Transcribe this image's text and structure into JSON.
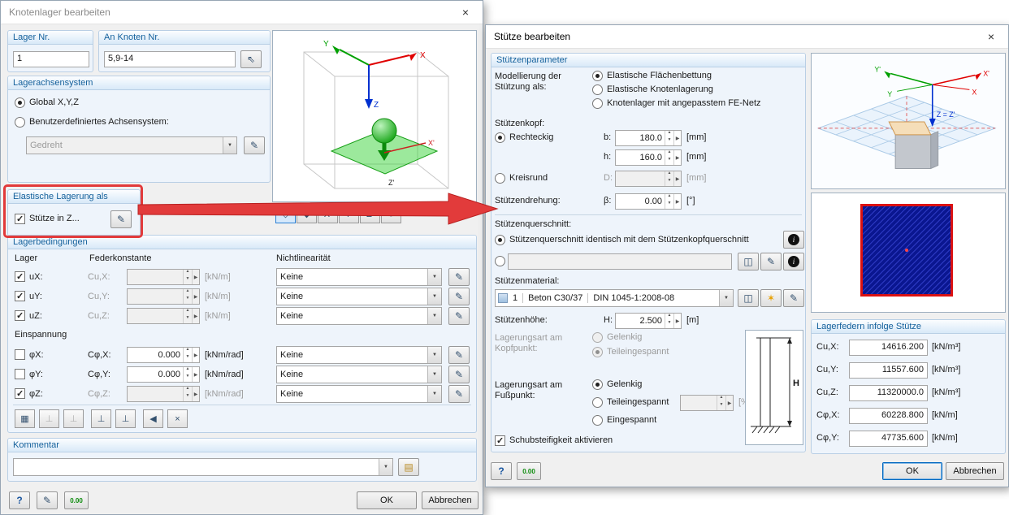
{
  "icons": {
    "close": "×",
    "pick": "⇖",
    "edit": "✎",
    "help": "?",
    "units": "0.00",
    "library": "◫",
    "new": "✶",
    "info": "i",
    "notes": "▤"
  },
  "left": {
    "title": "Knotenlager bearbeiten",
    "lager_nr": {
      "title": "Lager Nr.",
      "value": "1"
    },
    "an_knoten": {
      "title": "An Knoten Nr.",
      "value": "5,9-14"
    },
    "achsen": {
      "title": "Lagerachsensystem",
      "opt_global": "Global X,Y,Z",
      "opt_custom": "Benutzerdefiniertes Achsensystem:",
      "combo_value": "Gedreht"
    },
    "elastisch": {
      "title": "Elastische Lagerung als",
      "check_label": "Stütze in Z..."
    },
    "preview": {
      "axis_x": "X",
      "axis_y": "Y",
      "axis_z": "Z",
      "axis_xp": "X'",
      "axis_zp": "Z'",
      "toolbar": [
        "◇",
        "◆",
        "X'",
        "Y'",
        "Z'",
        "↺"
      ]
    },
    "bedingungen": {
      "title": "Lagerbedingungen",
      "col_lager": "Lager",
      "col_feder": "Federkonstante",
      "col_nl": "Nichtlinearität",
      "einspannung": "Einspannung",
      "rows": [
        {
          "label": "uX:",
          "coef": "Cu,X:",
          "value": "",
          "unit": "[kN/m]",
          "nl": "Keine"
        },
        {
          "label": "uY:",
          "coef": "Cu,Y:",
          "value": "",
          "unit": "[kN/m]",
          "nl": "Keine"
        },
        {
          "label": "uZ:",
          "coef": "Cu,Z:",
          "value": "",
          "unit": "[kN/m]",
          "nl": "Keine"
        },
        {
          "label": "φX:",
          "coef": "Cφ,X:",
          "value": "0.000",
          "unit": "[kNm/rad]",
          "nl": "Keine"
        },
        {
          "label": "φY:",
          "coef": "Cφ,Y:",
          "value": "0.000",
          "unit": "[kNm/rad]",
          "nl": "Keine"
        },
        {
          "label": "φZ:",
          "coef": "Cφ,Z:",
          "value": "",
          "unit": "[kNm/rad]",
          "nl": "Keine"
        }
      ],
      "presets": [
        "▦",
        "⊥",
        "⊥",
        "⊥",
        "⊥",
        "◀",
        "×"
      ]
    },
    "kommentar": {
      "title": "Kommentar",
      "value": ""
    },
    "ok": "OK",
    "cancel": "Abbrechen"
  },
  "right": {
    "title": "Stütze bearbeiten",
    "param_title": "Stützenparameter",
    "modellierung": {
      "label": "Modellierung der Stützung als:",
      "opt1": "Elastische Flächenbettung",
      "opt2": "Elastische Knotenlagerung",
      "opt3": "Knotenlager mit angepasstem FE-Netz"
    },
    "kopf": {
      "label": "Stützenkopf:",
      "opt_rect": "Rechteckig",
      "b_label": "b:",
      "b_value": "180.0",
      "b_unit": "[mm]",
      "h_label": "h:",
      "h_value": "160.0",
      "h_unit": "[mm]",
      "opt_round": "Kreisrund",
      "d_label": "D:",
      "d_value": "",
      "d_unit": "[mm]"
    },
    "drehung": {
      "label": "Stützendrehung:",
      "beta_label": "β:",
      "value": "0.00",
      "unit": "[°]"
    },
    "querschnitt": {
      "label": "Stützenquerschnitt:",
      "opt_identical": "Stützenquerschnitt identisch mit dem Stützenkopfquerschnitt",
      "custom_value": ""
    },
    "material": {
      "label": "Stützenmaterial:",
      "num": "1",
      "name": "Beton C30/37",
      "norm": "DIN 1045-1:2008-08"
    },
    "hoehe": {
      "label": "Stützenhöhe:",
      "h_label": "H:",
      "value": "2.500",
      "unit": "[m]"
    },
    "kopfpunkt": {
      "label": "Lagerungsart am Kopfpunkt:",
      "opt1": "Gelenkig",
      "opt2": "Teileingespannt"
    },
    "fusspunkt": {
      "label": "Lagerungsart am Fußpunkt:",
      "opt1": "Gelenkig",
      "opt2": "Teileingespannt",
      "opt2_value": "",
      "opt2_unit": "[%]",
      "opt3": "Eingespannt"
    },
    "schub": "Schubsteifigkeit aktivieren",
    "figure_h": "H",
    "preview": {
      "xp": "X'",
      "x": "X",
      "yp": "Y'",
      "y": "Y",
      "z": "Z = Z'"
    },
    "federn": {
      "title": "Lagerfedern infolge Stütze",
      "rows": [
        {
          "label": "Cu,X:",
          "value": "14616.200",
          "unit": "[kN/m³]"
        },
        {
          "label": "Cu,Y:",
          "value": "11557.600",
          "unit": "[kN/m³]"
        },
        {
          "label": "Cu,Z:",
          "value": "11320000.0",
          "unit": "[kN/m³]"
        },
        {
          "label": "Cφ,X:",
          "value": "60228.800",
          "unit": "[kN/m]"
        },
        {
          "label": "Cφ,Y:",
          "value": "47735.600",
          "unit": "[kN/m]"
        }
      ]
    },
    "ok": "OK",
    "cancel": "Abbrechen"
  }
}
